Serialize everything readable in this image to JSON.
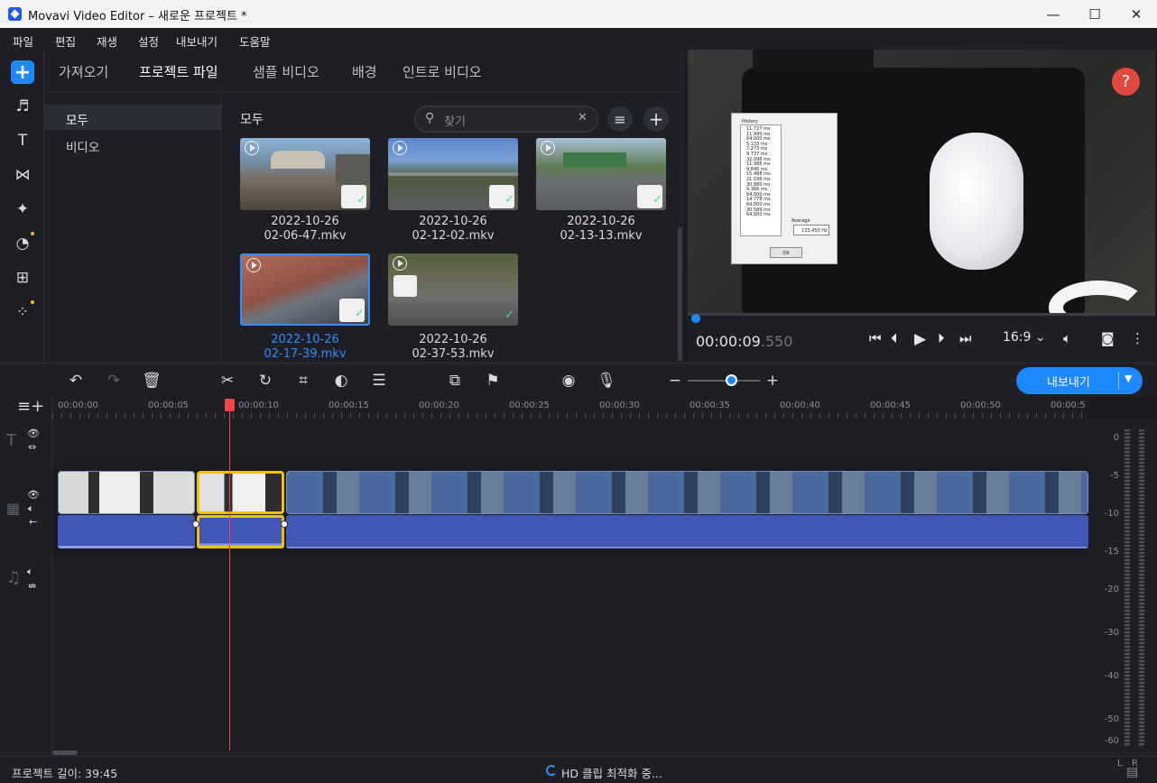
{
  "window": {
    "title": "Movavi Video Editor – 새로운 프로젝트 *",
    "minimize": "—",
    "maximize": "☐",
    "close": "✕"
  },
  "menu": [
    "파일",
    "편집",
    "재생",
    "설정",
    "내보내기",
    "도움말"
  ],
  "import_tabs": [
    "가져오기",
    "프로젝트 파일",
    "샘플 비디오",
    "배경",
    "인트로 비디오"
  ],
  "categories": [
    "모두",
    "비디오"
  ],
  "media": {
    "header": "모두",
    "search_placeholder": "찾기",
    "items": [
      {
        "date": "2022-10-26",
        "name": "02-06-47.mkv",
        "selected": false
      },
      {
        "date": "2022-10-26",
        "name": "02-12-02.mkv",
        "selected": false
      },
      {
        "date": "2022-10-26",
        "name": "02-13-13.mkv",
        "selected": false
      },
      {
        "date": "2022-10-26",
        "name": "02-17-39.mkv",
        "selected": true
      },
      {
        "date": "2022-10-26",
        "name": "02-37-53.mkv",
        "selected": false
      }
    ]
  },
  "preview": {
    "help": "?",
    "timecode_main": "00:00:09",
    "timecode_ms": ".550",
    "aspect": "16:9",
    "history_title": "History",
    "history_values": [
      "11.727 ms",
      "11.990 ms",
      "64.000 ms",
      "5.133 ms",
      "7.273 ms",
      "9.737 ms",
      "32.096 ms",
      "11.985 ms",
      "9.846 ms",
      "15.488 ms",
      "21.036 ms",
      "30.880 ms",
      "4.366 ms",
      "64.000 ms",
      "14.778 ms",
      "64.000 ms",
      "30.589 ms",
      "64.000 ms"
    ],
    "average_label": "Average",
    "average_value": "133.450 Hz",
    "ok": "OK"
  },
  "timeline": {
    "ruler": [
      "00:00:00",
      "00:00:05",
      "00:00:10",
      "00:00:15",
      "00:00:20",
      "00:00:25",
      "00:00:30",
      "00:00:35",
      "00:00:40",
      "00:00:45",
      "00:00:50",
      "00:00:5"
    ],
    "meter_labels": [
      "0",
      "-5",
      "-10",
      "-15",
      "-20",
      "-30",
      "-40",
      "-50",
      "-60"
    ],
    "meter_l": "L",
    "meter_r": "R"
  },
  "export_label": "내보내기",
  "status": {
    "project_length": "프로젝트 길이: 39:45",
    "optimizing": "HD 클립 최적화 중..."
  },
  "colors": {
    "accent": "#1e88ff",
    "playhead": "#f04848",
    "selected_clip": "#f2c200",
    "audio_clip": "#4257b5"
  },
  "icons": [
    "add-media-icon",
    "music-icon",
    "title-icon",
    "transition-icon",
    "effects-icon",
    "filters-icon",
    "stickers-icon",
    "more-tools-icon",
    "undo-icon",
    "redo-icon",
    "delete-icon",
    "cut-icon",
    "rotate-icon",
    "crop-icon",
    "color-adjust-icon",
    "clip-properties-icon",
    "overlay-icon",
    "marker-icon",
    "webcam-icon",
    "microphone-icon"
  ]
}
